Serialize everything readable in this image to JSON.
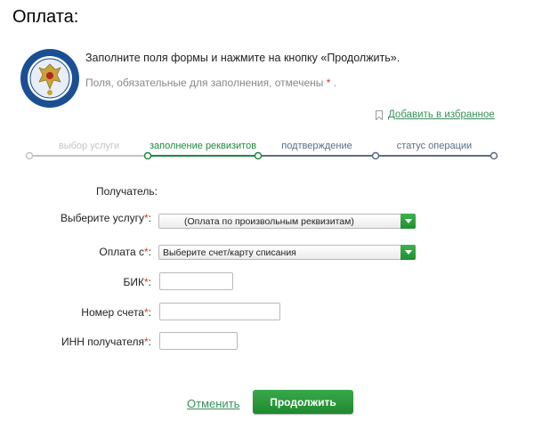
{
  "page": {
    "title": "Оплата:"
  },
  "intro": {
    "instruction": "Заполните поля формы и нажмите на кнопку «Продолжить».",
    "required_note": "Поля, обязательные для заполнения, отмечены",
    "required_star": "*",
    "required_end": "."
  },
  "favorites": {
    "label": "Добавить в избранное"
  },
  "steps": [
    {
      "label": "выбор услуги",
      "state": "done"
    },
    {
      "label": "заполнение реквизитов",
      "state": "active"
    },
    {
      "label": "подтверждение",
      "state": "todo"
    },
    {
      "label": "статус операции",
      "state": "todo"
    }
  ],
  "form": {
    "receiver_label": "Получатель:",
    "required_mark": "*",
    "service": {
      "label": "Выберите услугу",
      "colon": ":",
      "value": "(Оплата по произвольным реквизитам)"
    },
    "payment_from": {
      "label": "Оплата с",
      "colon": ":",
      "value": "Выберите счет/карту списания"
    },
    "bik": {
      "label": "БИК",
      "colon": ":",
      "value": ""
    },
    "account": {
      "label": "Номер счета",
      "colon": ":",
      "value": ""
    },
    "inn": {
      "label": "ИНН получателя",
      "colon": ":",
      "value": ""
    }
  },
  "actions": {
    "cancel_label": "Отменить",
    "continue_label": "Продолжить"
  },
  "colors": {
    "accent_green": "#1e8a3a",
    "link_green": "#3a8f5c",
    "required_red": "#e0312a",
    "progress_done": "#c4c4c4",
    "progress_todo": "#5b6e82"
  },
  "icons": {
    "logo": "tax-service-emblem-icon",
    "favorite": "bookmark-icon",
    "dropdown": "dropdown-arrow-icon"
  }
}
